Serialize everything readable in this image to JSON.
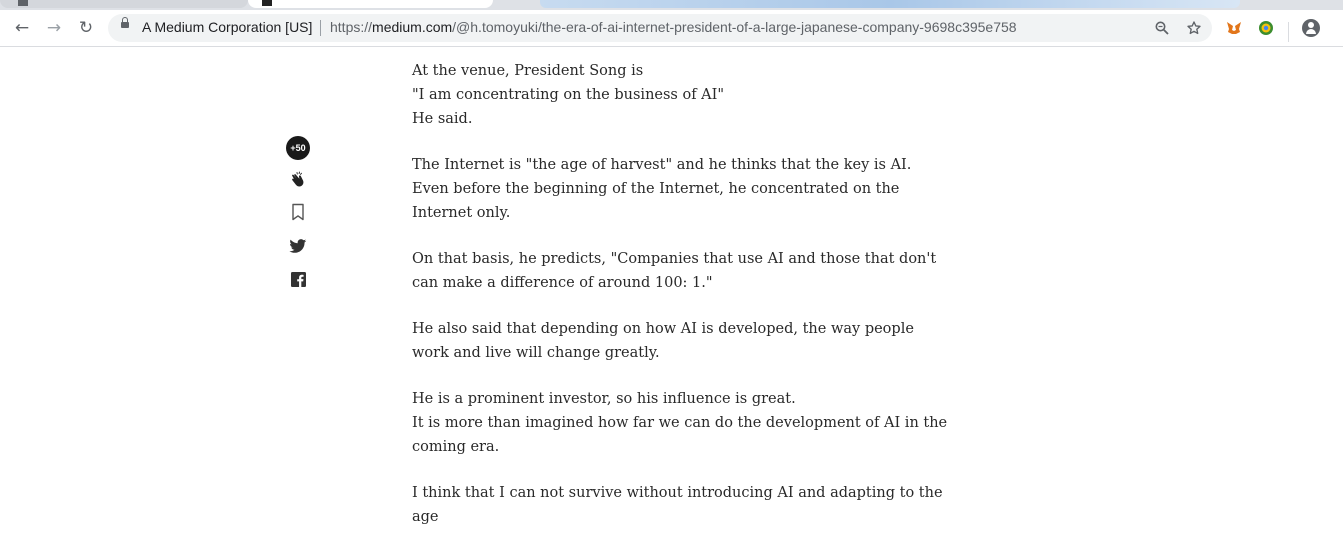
{
  "browser": {
    "site_identity": "A Medium Corporation [US]",
    "url_host": "medium.com",
    "url_path": "/@h.tomoyuki/the-era-of-ai-internet-president-of-a-large-japanese-company-9698c395e758",
    "url_scheme": "https://"
  },
  "rail": {
    "clap_count": "+50"
  },
  "article": {
    "paragraphs": [
      "At the venue, President Song is\n\"I am concentrating on the business of AI\"\nHe said.",
      "The Internet is \"the age of harvest\" and he thinks that the key is AI.\nEven before the beginning of the Internet, he concentrated on the Internet only.",
      "On that basis, he predicts, \"Companies that use AI and those that don't can make a difference of around 100: 1.\"",
      "He also said that depending on how AI is developed, the way people work and live will change greatly.",
      "He is a prominent investor, so his influence is great.\nIt is more than imagined how far we can do the development of AI in the coming era.",
      "I think that I can not survive without introducing AI and adapting to the age"
    ]
  }
}
